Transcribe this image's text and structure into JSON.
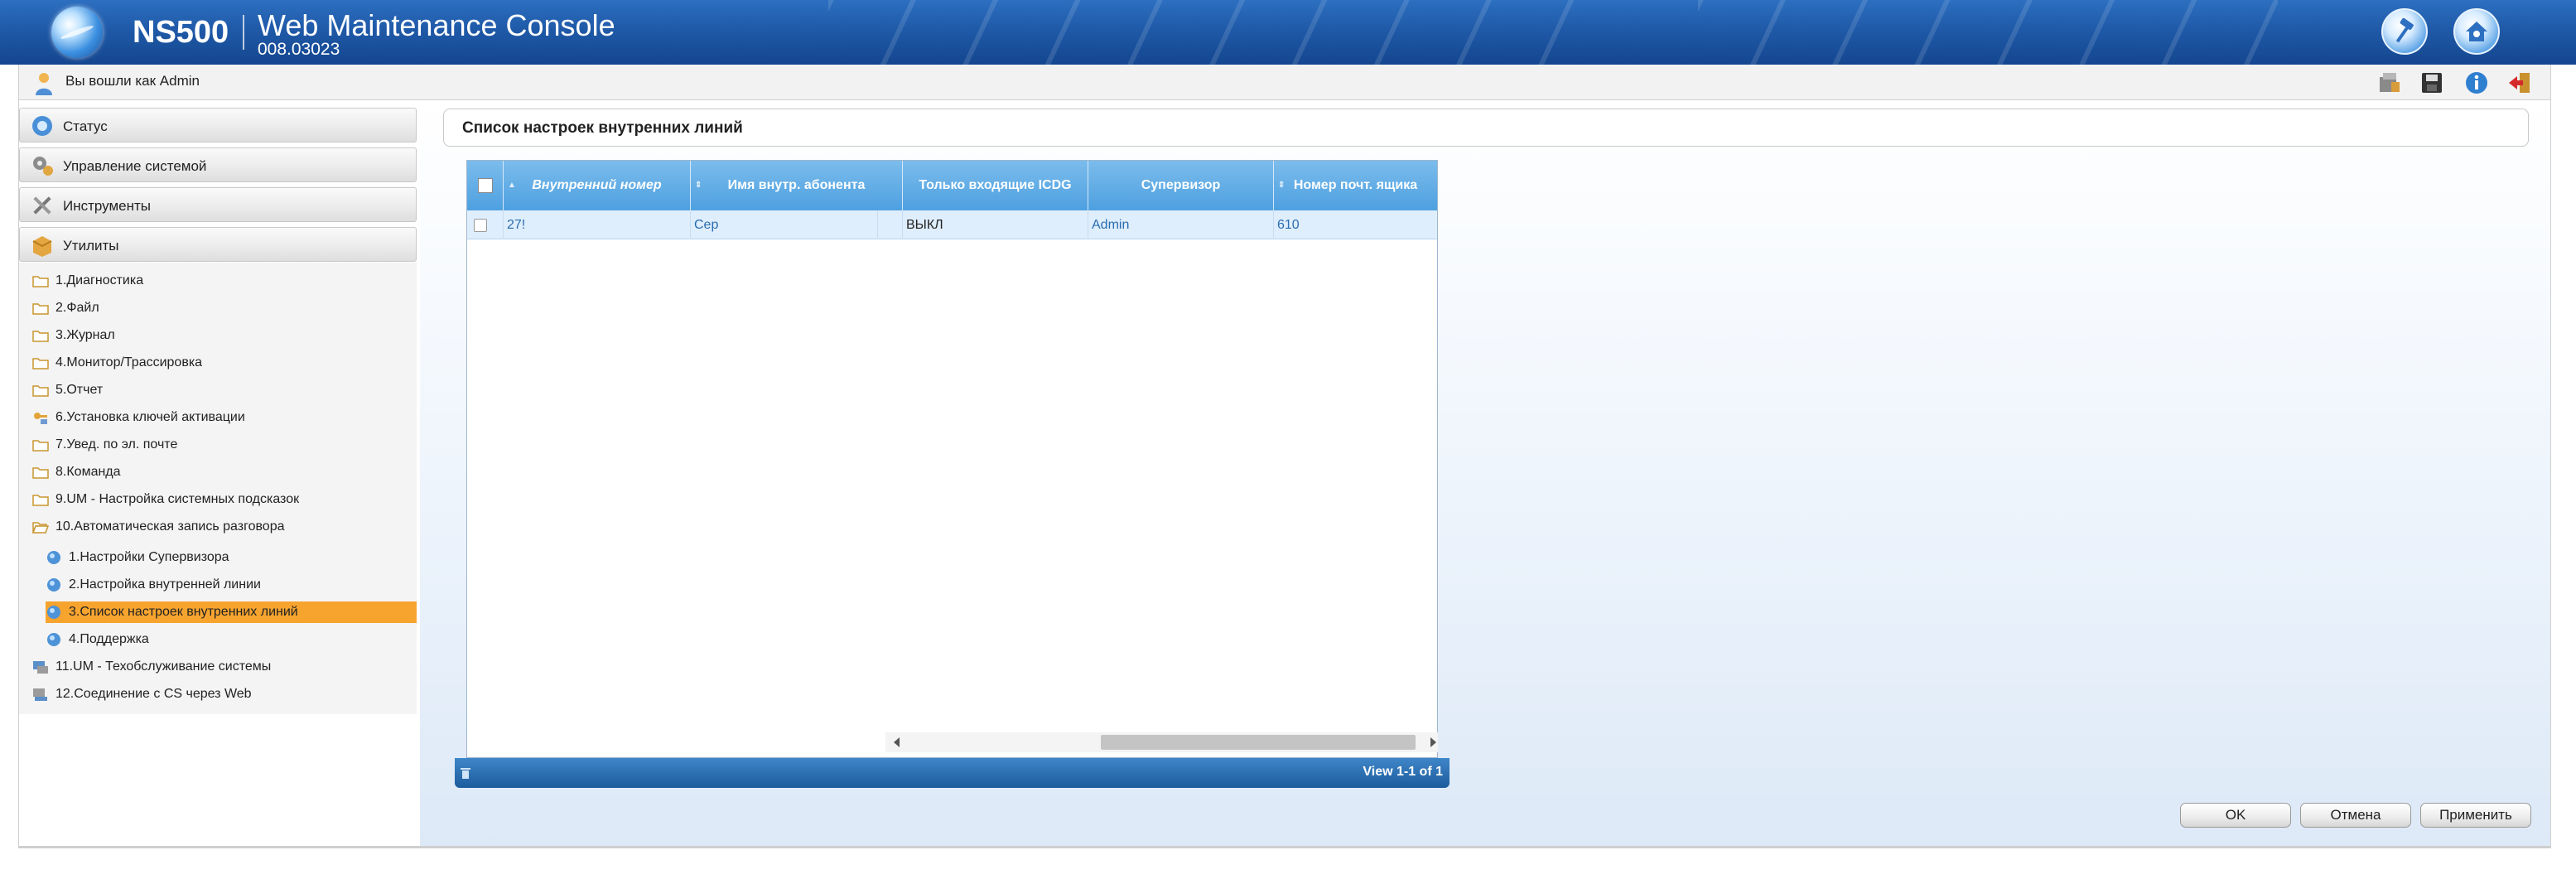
{
  "header": {
    "product": "NS500",
    "console_title": "Web Maintenance Console",
    "version": "008.03023",
    "colors": {
      "header_blue": "#1f5aa8",
      "accent_orange": "#f7a42f",
      "grid_header": "#4ea0e0"
    }
  },
  "userbar": {
    "login_text": "Вы вошли как Admin",
    "icons": [
      "phone-system-icon",
      "save-icon",
      "info-icon",
      "logout-icon"
    ]
  },
  "sidebar": {
    "accordions": [
      {
        "label": "Статус",
        "icon": "status-icon"
      },
      {
        "label": "Управление системой",
        "icon": "system-control-icon"
      },
      {
        "label": "Инструменты",
        "icon": "tools-icon"
      },
      {
        "label": "Утилиты",
        "icon": "utilities-icon"
      }
    ],
    "tree": [
      {
        "label": "1.Диагностика",
        "icon": "folder-icon"
      },
      {
        "label": "2.Файл",
        "icon": "folder-icon"
      },
      {
        "label": "3.Журнал",
        "icon": "folder-icon"
      },
      {
        "label": "4.Монитор/Трассировка",
        "icon": "folder-icon"
      },
      {
        "label": "5.Отчет",
        "icon": "folder-icon"
      },
      {
        "label": "6.Установка ключей активации",
        "icon": "key-icon"
      },
      {
        "label": "7.Увед. по эл. почте",
        "icon": "folder-icon"
      },
      {
        "label": "8.Команда",
        "icon": "folder-icon"
      },
      {
        "label": "9.UM - Настройка системных подсказок",
        "icon": "folder-icon"
      },
      {
        "label": "10.Автоматическая запись разговора",
        "icon": "folder-open-icon"
      },
      {
        "label": "1.Настройки Супервизора",
        "icon": "globe-icon"
      },
      {
        "label": "2.Настройка внутренней линии",
        "icon": "globe-icon"
      },
      {
        "label": "3.Список настроек внутренних линий",
        "icon": "globe-icon",
        "selected": true
      },
      {
        "label": "4.Поддержка",
        "icon": "globe-icon"
      },
      {
        "label": "11.UM - Техобслуживание системы",
        "icon": "monitor-icon"
      },
      {
        "label": "12.Соединение с CS через Web",
        "icon": "monitor-icon"
      }
    ]
  },
  "main": {
    "page_title": "Список настроек внутренних линий",
    "grid": {
      "columns": [
        "Внутренний номер",
        "Имя внутр. абонента",
        "Только входящие ICDG",
        "Супервизор",
        "Номер почт. ящика"
      ],
      "rows": [
        {
          "ext": "27!",
          "name": "Сер",
          "icdg": "ВЫКЛ",
          "supervisor": "Admin",
          "mailbox": "610"
        }
      ],
      "pager_text": "View 1-1 of 1"
    },
    "buttons": {
      "ok": "OK",
      "cancel": "Отмена",
      "apply": "Применить"
    }
  }
}
